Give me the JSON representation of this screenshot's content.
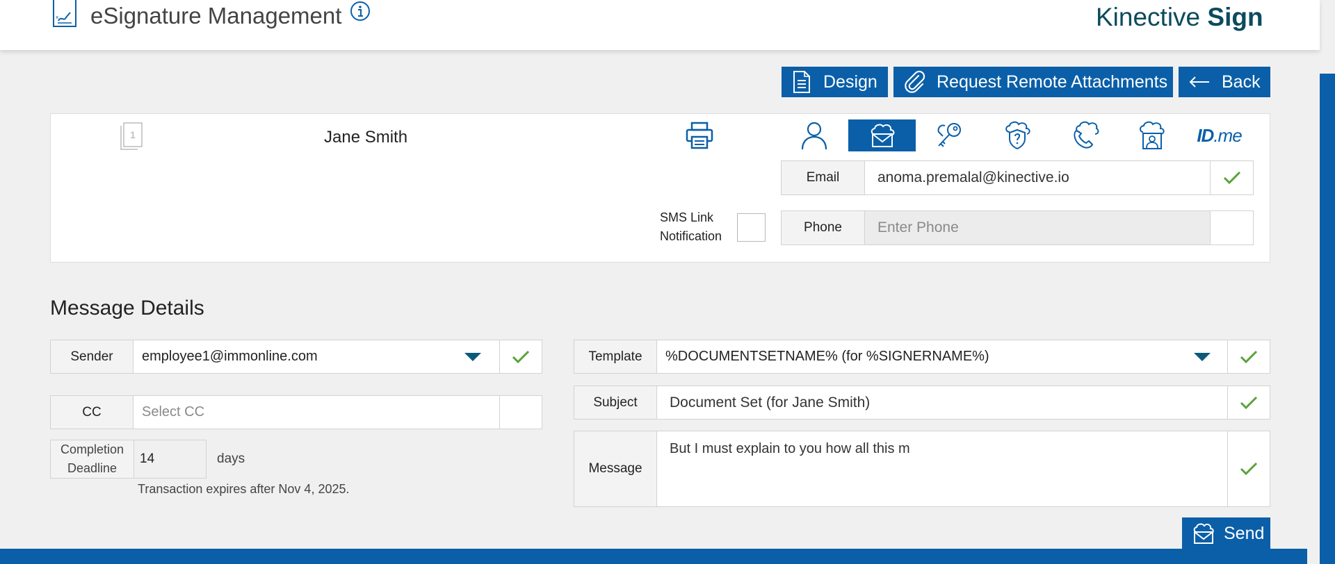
{
  "header": {
    "app_title": "eSignature Management",
    "brand_regular": "Kinective ",
    "brand_bold": "Sign"
  },
  "actions": {
    "design": "Design",
    "remote_attachments": "Request Remote Attachments",
    "back": "Back",
    "send": "Send"
  },
  "signer": {
    "page_count": "1",
    "name": "Jane Smith",
    "auth_tabs": [
      {
        "icon": "person-icon",
        "active": false
      },
      {
        "icon": "envelope-cloud-icon",
        "active": true
      },
      {
        "icon": "keys-icon",
        "active": false
      },
      {
        "icon": "shield-question-icon",
        "active": false
      },
      {
        "icon": "phone-cloud-icon",
        "active": false
      },
      {
        "icon": "id-badge-icon",
        "active": false
      },
      {
        "icon": "idme-logo",
        "active": false
      }
    ],
    "idme_bold": "ID",
    "idme_dot": ".me",
    "email_label": "Email",
    "email_value": "anoma.premalal@kinective.io",
    "sms_label_line1": "SMS Link",
    "sms_label_line2": "Notification",
    "phone_label": "Phone",
    "phone_placeholder": "Enter Phone"
  },
  "message_details": {
    "title": "Message Details",
    "sender_label": "Sender",
    "sender_value": "employee1@immonline.com",
    "cc_label": "CC",
    "cc_placeholder": "Select CC",
    "deadline_label_line1": "Completion",
    "deadline_label_line2": "Deadline",
    "deadline_value": "14",
    "deadline_unit": "days",
    "expires_text": "Transaction expires after Nov 4, 2025.",
    "template_label": "Template",
    "template_value": "%DOCUMENTSETNAME% (for %SIGNERNAME%)",
    "subject_label": "Subject",
    "subject_value": "Document Set (for Jane Smith)",
    "message_label": "Message",
    "message_value": "But I must explain to you how all this m"
  },
  "colors": {
    "primary": "#0a5fa8",
    "check": "#5aa33a",
    "brand_text": "#0c4a5e"
  }
}
